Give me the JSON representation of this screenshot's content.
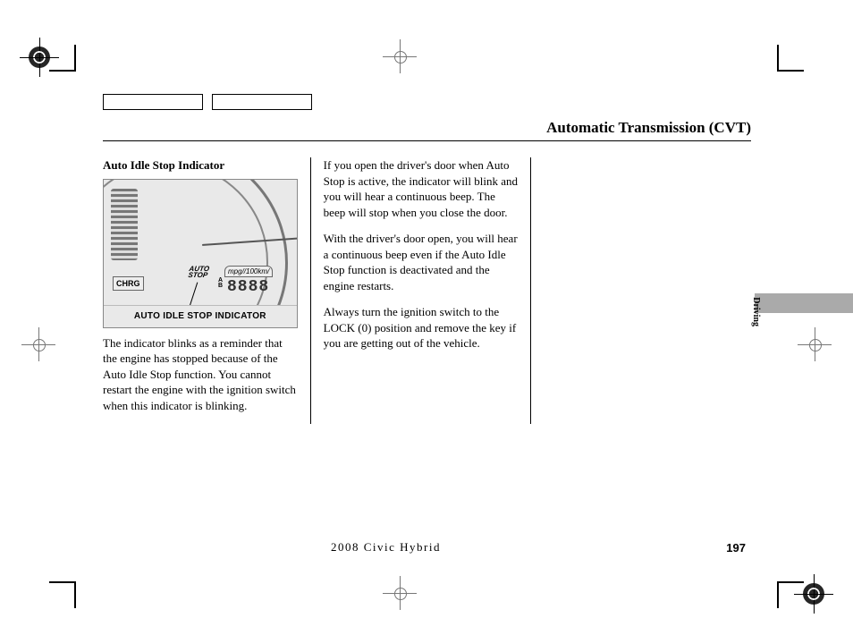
{
  "header": {
    "title": "Automatic Transmission (CVT)"
  },
  "section": {
    "heading": "Auto Idle Stop Indicator",
    "figure_caption": "AUTO IDLE STOP INDICATOR",
    "figure_labels": {
      "chrg": "CHRG",
      "auto_stop_1": "AUTO",
      "auto_stop_2": "STOP",
      "mpg": "mpg//100km/",
      "seg": "8888",
      "ab_a": "A",
      "ab_b": "B"
    },
    "col1_para": "The indicator blinks as a reminder that the engine has stopped because of the Auto Idle Stop function. You cannot restart the engine with the ignition switch when this indicator is blinking.",
    "col2_para1": "If you open the driver's door when Auto Stop is active, the indicator will blink and you will hear a continuous beep. The beep will stop when you close the door.",
    "col2_para2": "With the driver's door open, you will hear a continuous beep even if the Auto Idle Stop function is deactivated and the engine restarts.",
    "col2_para3": "Always turn the ignition switch to the LOCK (0) position and remove the key if you are getting out of the vehicle."
  },
  "side_tab": "Driving",
  "footer": {
    "model": "2008  Civic  Hybrid",
    "page": "197"
  }
}
